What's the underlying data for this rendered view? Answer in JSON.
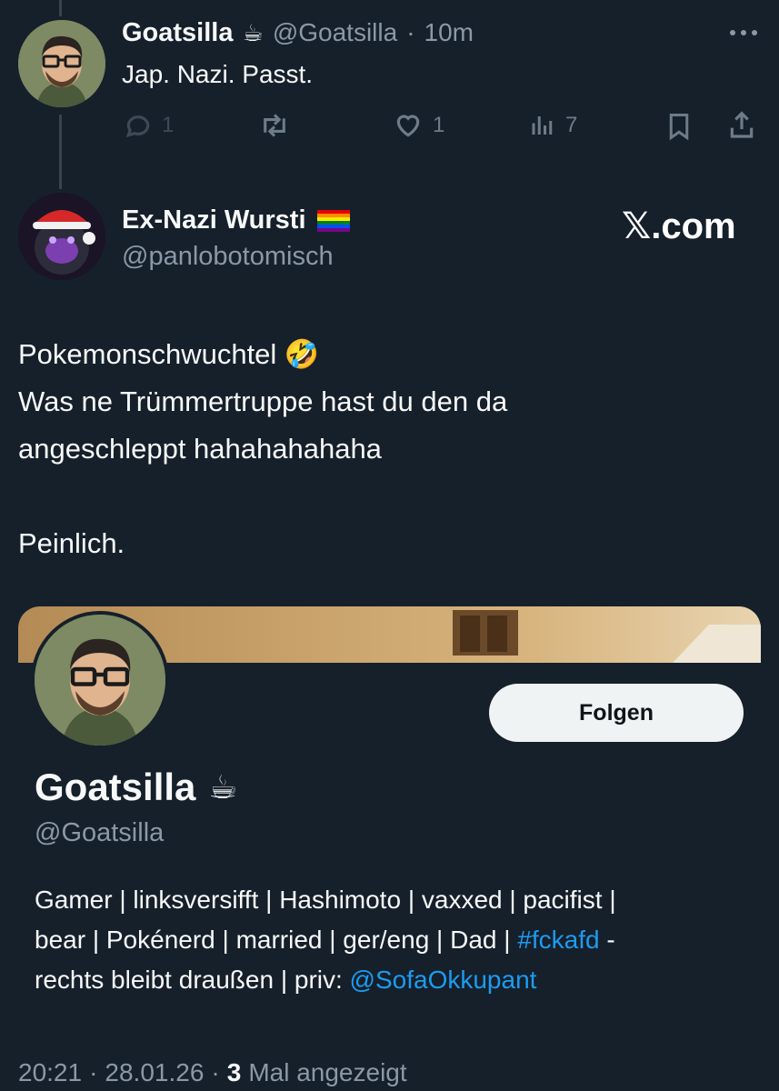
{
  "reply_tweet": {
    "author_name": "Goatsilla",
    "author_emoji": "☕",
    "handle": "@Goatsilla",
    "separator": "·",
    "time": "10m",
    "text": "Jap. Nazi. Passt.",
    "actions": {
      "reply_count": "1",
      "like_count": "1",
      "views_count": "7"
    },
    "more_icon": "more-dots-icon"
  },
  "main_tweet": {
    "author_name": "Ex-Nazi Wursti",
    "author_flag": "rainbow-flag-icon",
    "handle": "@panlobotomisch",
    "brand": "𝕏.com",
    "text_line1": "Pokemonschwuchtel 🤣",
    "text_rest": "Was ne Trümmertruppe hast du den da\nangeschleppt hahahahahaha\n\nPeinlich."
  },
  "profile_card": {
    "follow_label": "Folgen",
    "name": "Goatsilla",
    "name_emoji": "☕",
    "handle": "@Goatsilla",
    "bio_line1": "Gamer | linksversifft | Hashimoto | vaxxed | pacifist |",
    "bio_line2_pre": "bear | Pokénerd | married | ger/eng | Dad | ",
    "bio_hashtag": "#fckafd",
    "bio_line2_post": " -",
    "bio_line3_pre": "rechts bleibt draußen | priv: ",
    "bio_mention": "@SofaOkkupant"
  },
  "footer": {
    "time": "20:21",
    "separator1": "·",
    "date": "28.01.26",
    "separator2": "·",
    "view_count": "3",
    "view_label": "Mal angezeigt"
  },
  "colors": {
    "background": "#15202b",
    "text": "#f7f9f9",
    "muted": "#8b98a5",
    "link": "#1d9bf0",
    "button_bg": "#eff3f4"
  }
}
